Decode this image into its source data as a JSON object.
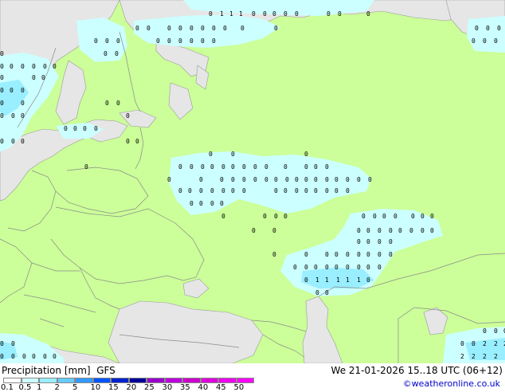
{
  "map": {
    "colors": {
      "land": "#ccff99",
      "sea": "#e6e6e6",
      "precip_light": "#ccffff",
      "precip_medium": "#99eeff",
      "precip_heavy": "#66ccff",
      "borders": "#808080"
    },
    "precip_symbols": [
      "0",
      "1",
      "2"
    ]
  },
  "footer": {
    "left_title": "Precipitation [mm]  GFS",
    "right_title": "We 21-01-2026 15..18 UTC (06+12)",
    "credit": "©weatheronline.co.uk"
  },
  "scale": {
    "labels": [
      "0.1",
      "0.5",
      "1",
      "2",
      "5",
      "10",
      "15",
      "20",
      "25",
      "30",
      "35",
      "40",
      "45",
      "50"
    ],
    "colors": [
      "#ffffff",
      "#ccffff",
      "#99eeff",
      "#66ccff",
      "#3399ff",
      "#0055ff",
      "#0022cc",
      "#000099",
      "#9900cc",
      "#bb00dd",
      "#cc00cc",
      "#dd00dd",
      "#ee00ee",
      "#ff00ff"
    ]
  }
}
